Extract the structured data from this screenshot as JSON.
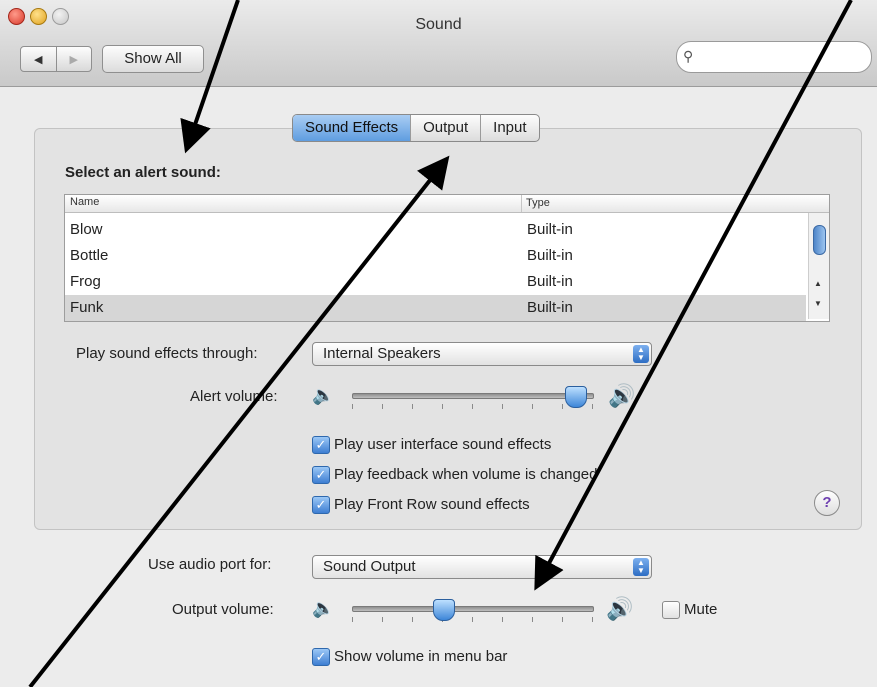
{
  "window": {
    "title": "Sound",
    "show_all": "Show All",
    "back": "◀",
    "forward": "▶",
    "search_placeholder": ""
  },
  "tabs": [
    {
      "label": "Sound Effects",
      "active": true
    },
    {
      "label": "Output",
      "active": false
    },
    {
      "label": "Input",
      "active": false
    }
  ],
  "alert_section": {
    "title": "Select an alert sound:",
    "columns": [
      "Name",
      "Type"
    ],
    "rows": [
      {
        "name": "Blow",
        "type": "Built-in",
        "selected": false
      },
      {
        "name": "Bottle",
        "type": "Built-in",
        "selected": false
      },
      {
        "name": "Frog",
        "type": "Built-in",
        "selected": false
      },
      {
        "name": "Funk",
        "type": "Built-in",
        "selected": true
      }
    ]
  },
  "play_through": {
    "label": "Play sound effects through:",
    "value": "Internal Speakers"
  },
  "alert_volume": {
    "label": "Alert volume:",
    "level": 0.93
  },
  "checkboxes": [
    {
      "label": "Play user interface sound effects",
      "checked": true
    },
    {
      "label": "Play feedback when volume is changed",
      "checked": true
    },
    {
      "label": "Play Front Row sound effects",
      "checked": true
    }
  ],
  "help": "?",
  "audio_port": {
    "label": "Use audio port for:",
    "value": "Sound Output"
  },
  "output_volume": {
    "label": "Output volume:",
    "level": 0.38,
    "mute_label": "Mute",
    "muted": false
  },
  "menu_bar": {
    "label": "Show volume in menu bar",
    "checked": true
  },
  "colors": {
    "active_tab": "#5f9de0",
    "control_blue": "#3d7ed2",
    "arrow": "#000000"
  }
}
